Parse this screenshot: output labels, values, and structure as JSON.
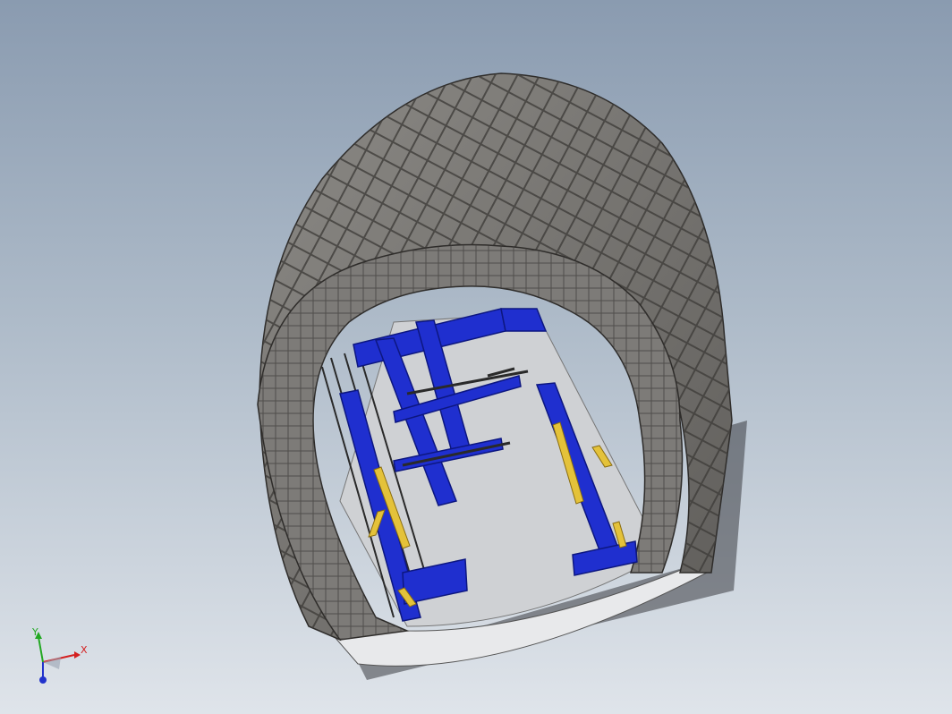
{
  "viewport": {
    "background_top": "#8a9bb0",
    "background_bottom": "#dfe4ea",
    "model": {
      "shell_color": "#7a7874",
      "shell_dark": "#4a4845",
      "frame_color": "#1f2fcf",
      "frame_dark": "#0d1780",
      "cylinder_color": "#e4c23a",
      "floor_color": "#cfd1d4"
    },
    "triad": {
      "x_label": "X",
      "y_label": "Y",
      "x_color": "#d42020",
      "y_color": "#22a822",
      "z_color": "#2233cc"
    }
  }
}
